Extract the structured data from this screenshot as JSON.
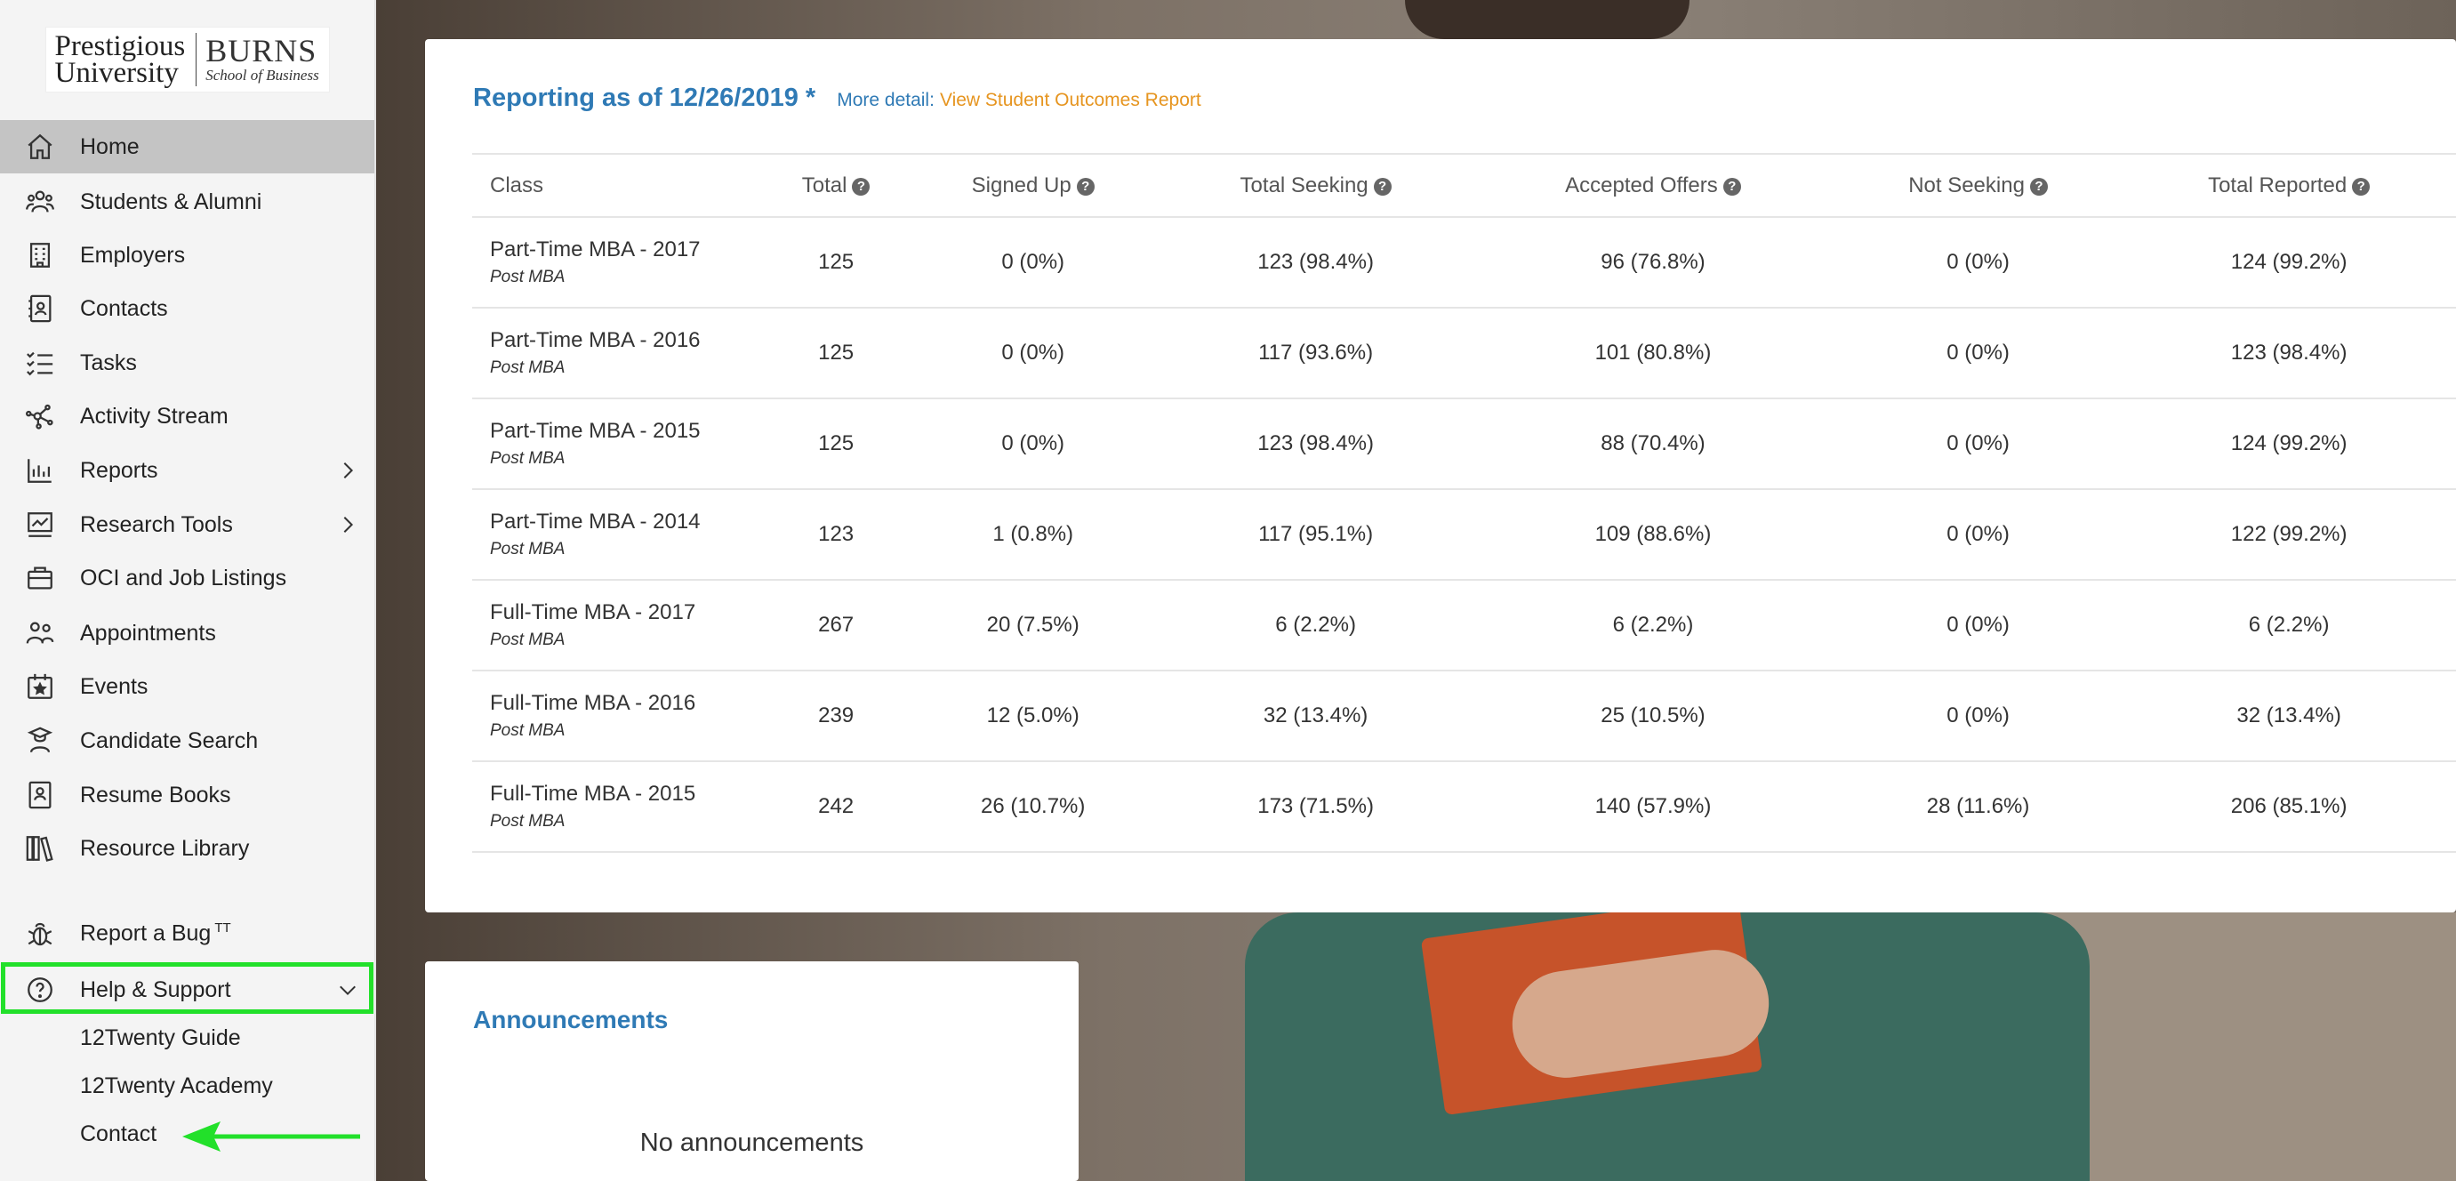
{
  "logo": {
    "left_line1": "Prestigious",
    "left_line2": "University",
    "right_big": "BURNS",
    "right_small": "School of Business"
  },
  "sidebar": {
    "items": [
      {
        "label": "Home",
        "icon": "home-icon"
      },
      {
        "label": "Students & Alumni",
        "icon": "people-icon"
      },
      {
        "label": "Employers",
        "icon": "building-icon"
      },
      {
        "label": "Contacts",
        "icon": "contact-card-icon"
      },
      {
        "label": "Tasks",
        "icon": "checklist-icon"
      },
      {
        "label": "Activity Stream",
        "icon": "network-icon"
      },
      {
        "label": "Reports",
        "icon": "bar-chart-icon"
      },
      {
        "label": "Research Tools",
        "icon": "trend-chart-icon"
      },
      {
        "label": "OCI and Job Listings",
        "icon": "briefcase-icon"
      },
      {
        "label": "Appointments",
        "icon": "appointments-icon"
      },
      {
        "label": "Events",
        "icon": "calendar-star-icon"
      },
      {
        "label": "Candidate Search",
        "icon": "graduate-icon"
      },
      {
        "label": "Resume Books",
        "icon": "resume-book-icon"
      },
      {
        "label": "Resource Library",
        "icon": "library-icon"
      }
    ],
    "report_bug": {
      "label": "Report a Bug",
      "sup": "TT"
    },
    "help": {
      "label": "Help & Support"
    },
    "help_sub": [
      "12Twenty Guide",
      "12Twenty Academy",
      "Contact"
    ]
  },
  "report": {
    "title": "Reporting as of 12/26/2019 *",
    "more_detail": "More detail:",
    "link": "View Student Outcomes Report",
    "columns": [
      "Class",
      "Total",
      "Signed Up",
      "Total Seeking",
      "Accepted Offers",
      "Not Seeking",
      "Total Reported"
    ],
    "rows": [
      {
        "name": "Part-Time MBA - 2017",
        "sub": "Post MBA",
        "total": "125",
        "signed_up": "0 (0%)",
        "seeking": "123 (98.4%)",
        "accepted": "96 (76.8%)",
        "not_seeking": "0 (0%)",
        "reported": "124 (99.2%)"
      },
      {
        "name": "Part-Time MBA - 2016",
        "sub": "Post MBA",
        "total": "125",
        "signed_up": "0 (0%)",
        "seeking": "117 (93.6%)",
        "accepted": "101 (80.8%)",
        "not_seeking": "0 (0%)",
        "reported": "123 (98.4%)"
      },
      {
        "name": "Part-Time MBA - 2015",
        "sub": "Post MBA",
        "total": "125",
        "signed_up": "0 (0%)",
        "seeking": "123 (98.4%)",
        "accepted": "88 (70.4%)",
        "not_seeking": "0 (0%)",
        "reported": "124 (99.2%)"
      },
      {
        "name": "Part-Time MBA - 2014",
        "sub": "Post MBA",
        "total": "123",
        "signed_up": "1 (0.8%)",
        "seeking": "117 (95.1%)",
        "accepted": "109 (88.6%)",
        "not_seeking": "0 (0%)",
        "reported": "122 (99.2%)"
      },
      {
        "name": "Full-Time MBA - 2017",
        "sub": "Post MBA",
        "total": "267",
        "signed_up": "20 (7.5%)",
        "seeking": "6 (2.2%)",
        "accepted": "6 (2.2%)",
        "not_seeking": "0 (0%)",
        "reported": "6 (2.2%)"
      },
      {
        "name": "Full-Time MBA - 2016",
        "sub": "Post MBA",
        "total": "239",
        "signed_up": "12 (5.0%)",
        "seeking": "32 (13.4%)",
        "accepted": "25 (10.5%)",
        "not_seeking": "0 (0%)",
        "reported": "32 (13.4%)"
      },
      {
        "name": "Full-Time MBA - 2015",
        "sub": "Post MBA",
        "total": "242",
        "signed_up": "26 (10.7%)",
        "seeking": "173 (71.5%)",
        "accepted": "140 (57.9%)",
        "not_seeking": "28 (11.6%)",
        "reported": "206 (85.1%)"
      }
    ]
  },
  "announcements": {
    "title": "Announcements",
    "empty": "No announcements"
  },
  "colors": {
    "accent_blue": "#2f7ab5",
    "link_orange": "#e69520",
    "highlight_green": "#22e02a",
    "active_gray": "#c4c4c4"
  }
}
